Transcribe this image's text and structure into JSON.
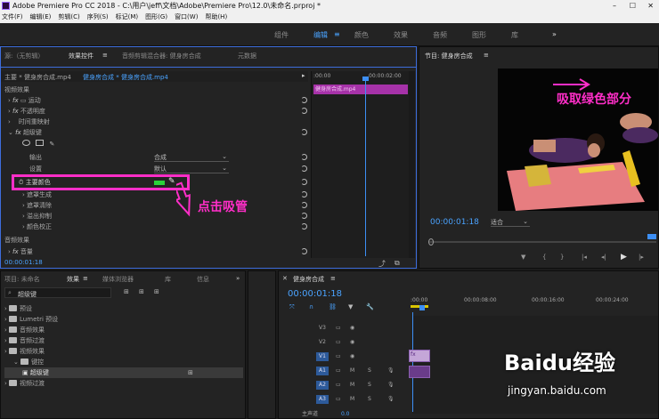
{
  "window": {
    "title": "Adobe Premiere Pro CC 2018 - C:\\用户\\jeff\\文档\\Adobe\\Premiere Pro\\12.0\\未命名.prproj *"
  },
  "menu": [
    "文件(F)",
    "编辑(E)",
    "剪辑(C)",
    "序列(S)",
    "标记(M)",
    "图形(G)",
    "窗口(W)",
    "帮助(H)"
  ],
  "workspaces": [
    "组件",
    "编辑",
    "颜色",
    "效果",
    "音频",
    "图形",
    "库"
  ],
  "workspace_active": "编辑",
  "workspace_more": "»",
  "effect_controls": {
    "tabs": [
      "源:（无剪辑）",
      "效果控件",
      "音频剪辑混合器: 健身房合成",
      "元数据"
    ],
    "clip_label": "主要 * 健身房合成.mp4",
    "seq_label": "健身房合成 * 健身房合成.mp4",
    "video_effects_header": "视频效果",
    "effects": [
      "运动",
      "不透明度",
      "时间重映射",
      "超级键"
    ],
    "output_label": "输出",
    "output_value": "合成",
    "settings_label": "设置",
    "settings_value": "默认",
    "key_color_label": "主要颜色",
    "key_color": "#27d33a",
    "sub_items": [
      "遮罩生成",
      "遮罩清除",
      "溢出抑制",
      "颜色校正"
    ],
    "audio_effects_header": "音频效果",
    "volume_label": "音量",
    "timecode": "00:00:01:18",
    "mini_timeline": {
      "t0": ":00:00",
      "t1": "00:00:02:00",
      "clip": "健身房合成.mp4"
    }
  },
  "annotations": {
    "eyedropper_hint": "点击吸管",
    "pick_green_hint": "吸取绿色部分"
  },
  "program": {
    "title": "节目: 健身房合成",
    "timecode": "00:00:01:18",
    "fit": "适合",
    "transport_icons": [
      "marker-icon",
      "in-point-icon",
      "out-point-icon",
      "go-to-in-icon",
      "step-back-icon",
      "play-icon",
      "step-forward-icon"
    ]
  },
  "project": {
    "tabs": [
      "项目: 未命名",
      "效果",
      "媒体浏览器",
      "库",
      "信息"
    ],
    "search_value": "超级键",
    "tree": [
      {
        "label": "预设",
        "level": 0
      },
      {
        "label": "Lumetri 预设",
        "level": 0
      },
      {
        "label": "音频效果",
        "level": 0
      },
      {
        "label": "音频过渡",
        "level": 0
      },
      {
        "label": "视频效果",
        "level": 0
      },
      {
        "label": "键控",
        "level": 1
      },
      {
        "label": "超级键",
        "level": 2
      },
      {
        "label": "视频过渡",
        "level": 0
      }
    ]
  },
  "timeline": {
    "title": "健身房合成",
    "timecode": "00:00:01:18",
    "ruler": [
      ":00:00",
      "00:00:08:00",
      "00:00:16:00",
      "00:00:24:00"
    ],
    "tracks": [
      "V3",
      "V2",
      "V1",
      "A1",
      "A2",
      "A3"
    ],
    "master": "主声道",
    "master_value": "0.0"
  },
  "watermark": {
    "brand": "Baidu经验",
    "url": "jingyan.baidu.com"
  }
}
